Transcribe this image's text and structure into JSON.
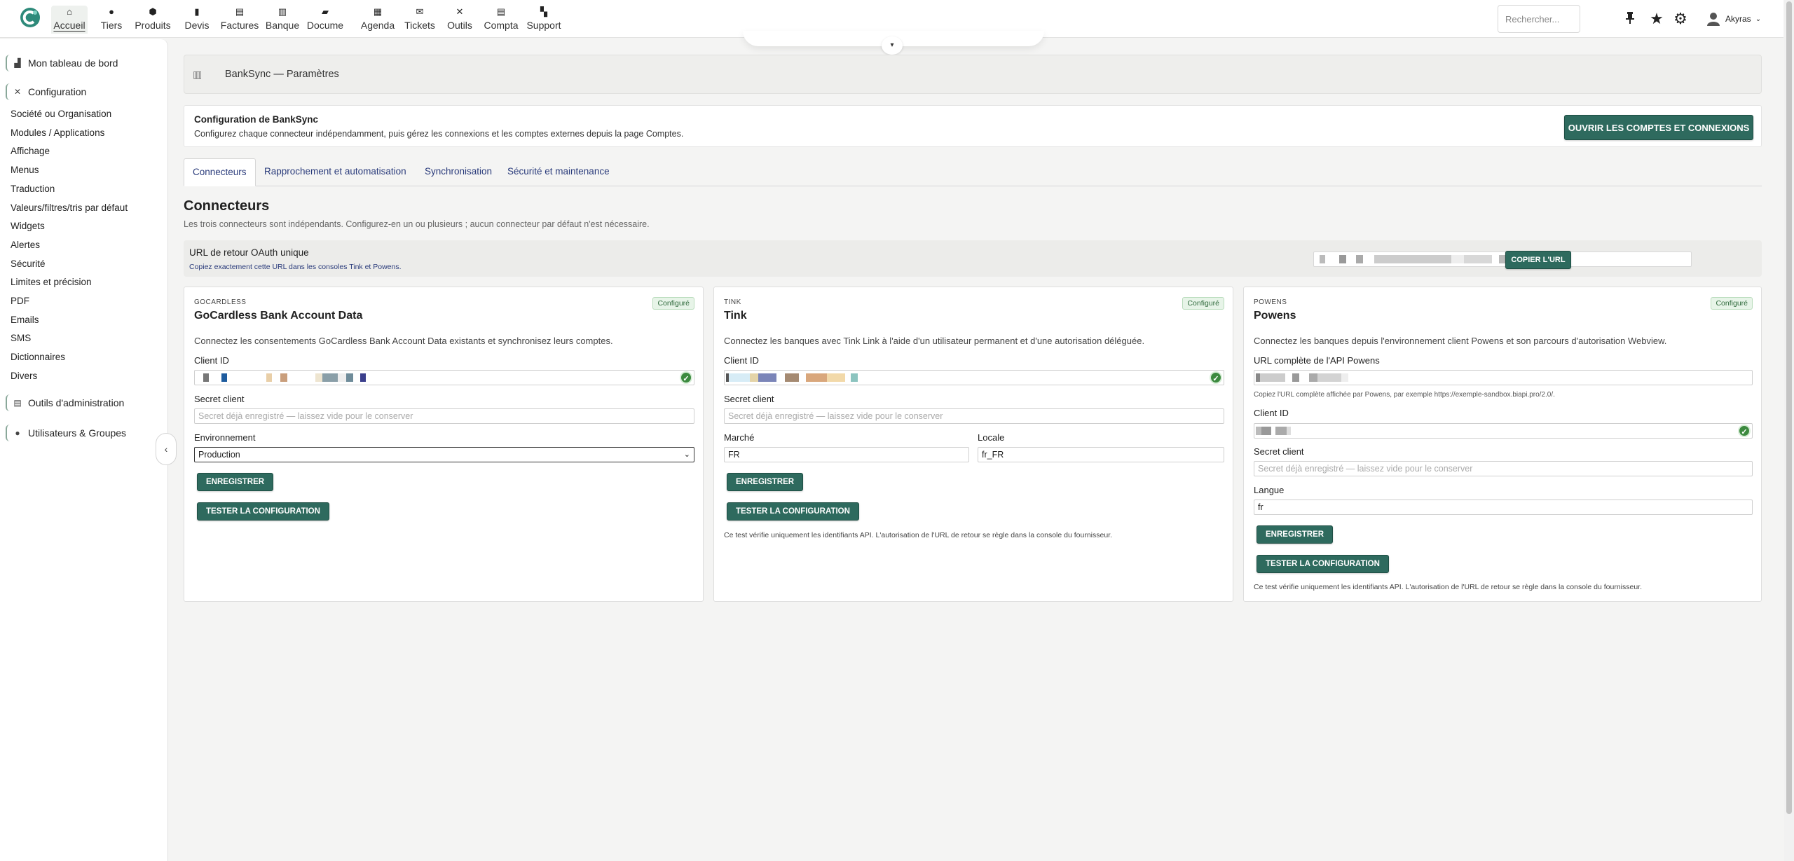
{
  "nav": {
    "items": [
      {
        "label": "Accueil",
        "icon": "home-icon",
        "glyph": "⌂"
      },
      {
        "label": "Tiers",
        "icon": "person-icon",
        "glyph": "●"
      },
      {
        "label": "Produits",
        "icon": "cube-icon",
        "glyph": "⬢"
      },
      {
        "label": "Devis",
        "icon": "briefcase-icon",
        "glyph": "▮"
      },
      {
        "label": "Factures",
        "icon": "invoice-icon",
        "glyph": "▤"
      },
      {
        "label": "Banque",
        "icon": "bank-icon",
        "glyph": "▥"
      },
      {
        "label": "Docume",
        "icon": "folder-icon",
        "glyph": "▰"
      },
      {
        "label": "Agenda",
        "icon": "calendar-icon",
        "glyph": "▦"
      },
      {
        "label": "Tickets",
        "icon": "ticket-icon",
        "glyph": "✉"
      },
      {
        "label": "Outils",
        "icon": "tools-icon",
        "glyph": "✕"
      },
      {
        "label": "Compta",
        "icon": "accounting-icon",
        "glyph": "▤"
      },
      {
        "label": "Support",
        "icon": "support-icon",
        "glyph": "▚"
      }
    ],
    "active_index": 0
  },
  "search": {
    "placeholder": "Rechercher..."
  },
  "user": {
    "name": "Akyras"
  },
  "sidebar": {
    "dashboard": "Mon tableau de bord",
    "configuration": "Configuration",
    "links": [
      "Société ou Organisation",
      "Modules / Applications",
      "Affichage",
      "Menus",
      "Traduction",
      "Valeurs/filtres/tris par défaut",
      "Widgets",
      "Alertes",
      "Sécurité",
      "Limites et précision",
      "PDF",
      "Emails",
      "SMS",
      "Dictionnaires",
      "Divers"
    ],
    "admin_tools": "Outils d'administration",
    "users_groups": "Utilisateurs & Groupes"
  },
  "page": {
    "title": "BankSync — Paramètres",
    "intro_title": "Configuration de BankSync",
    "intro_desc": "Configurez chaque connecteur indépendamment, puis gérez les connexions et les comptes externes depuis la page Comptes.",
    "open_button": "OUVRIR LES COMPTES ET CONNEXIONS"
  },
  "tabs": [
    {
      "label": "Connecteurs",
      "active": true
    },
    {
      "label": "Rapprochement et automatisation",
      "active": false
    },
    {
      "label": "Synchronisation",
      "active": false
    },
    {
      "label": "Sécurité et maintenance",
      "active": false
    }
  ],
  "section": {
    "title": "Connecteurs",
    "subtitle": "Les trois connecteurs sont indépendants. Configurez-en un ou plusieurs ; aucun connecteur par défaut n'est nécessaire."
  },
  "oauth": {
    "label": "URL de retour OAuth unique",
    "hint": "Copiez exactement cette URL dans les consoles Tink et Powens.",
    "copy_button": "COPIER L'URL"
  },
  "cards": {
    "gocardless": {
      "eyebrow": "GOCARDLESS",
      "title": "GoCardless Bank Account Data",
      "badge": "Configuré",
      "desc": "Connectez les consentements GoCardless Bank Account Data existants et synchronisez leurs comptes.",
      "client_id_label": "Client ID",
      "secret_label": "Secret client",
      "secret_placeholder": "Secret déjà enregistré — laissez vide pour le conserver",
      "env_label": "Environnement",
      "env_value": "Production",
      "save": "ENREGISTRER",
      "test": "TESTER LA CONFIGURATION"
    },
    "tink": {
      "eyebrow": "TINK",
      "title": "Tink",
      "badge": "Configuré",
      "desc": "Connectez les banques avec Tink Link à l'aide d'un utilisateur permanent et d'une autorisation déléguée.",
      "client_id_label": "Client ID",
      "secret_label": "Secret client",
      "secret_placeholder": "Secret déjà enregistré — laissez vide pour le conserver",
      "market_label": "Marché",
      "market_value": "FR",
      "locale_label": "Locale",
      "locale_value": "fr_FR",
      "save": "ENREGISTRER",
      "test": "TESTER LA CONFIGURATION",
      "note": "Ce test vérifie uniquement les identifiants API. L'autorisation de l'URL de retour se règle dans la console du fournisseur."
    },
    "powens": {
      "eyebrow": "POWENS",
      "title": "Powens",
      "badge": "Configuré",
      "desc": "Connectez les banques depuis l'environnement client Powens et son parcours d'autorisation Webview.",
      "api_url_label": "URL complète de l'API Powens",
      "api_url_hint": "Copiez l'URL complète affichée par Powens, par exemple https://exemple-sandbox.biapi.pro/2.0/.",
      "client_id_label": "Client ID",
      "secret_label": "Secret client",
      "secret_placeholder": "Secret déjà enregistré — laissez vide pour le conserver",
      "lang_label": "Langue",
      "lang_value": "fr",
      "save": "ENREGISTRER",
      "test": "TESTER LA CONFIGURATION",
      "note": "Ce test vérifie uniquement les identifiants API. L'autorisation de l'URL de retour se règle dans la console du fournisseur."
    }
  },
  "colors": {
    "accent": "#2e6a5e",
    "link": "#2a3b7b",
    "badge_text": "#2f6a3c",
    "check": "#3c8a3f"
  }
}
